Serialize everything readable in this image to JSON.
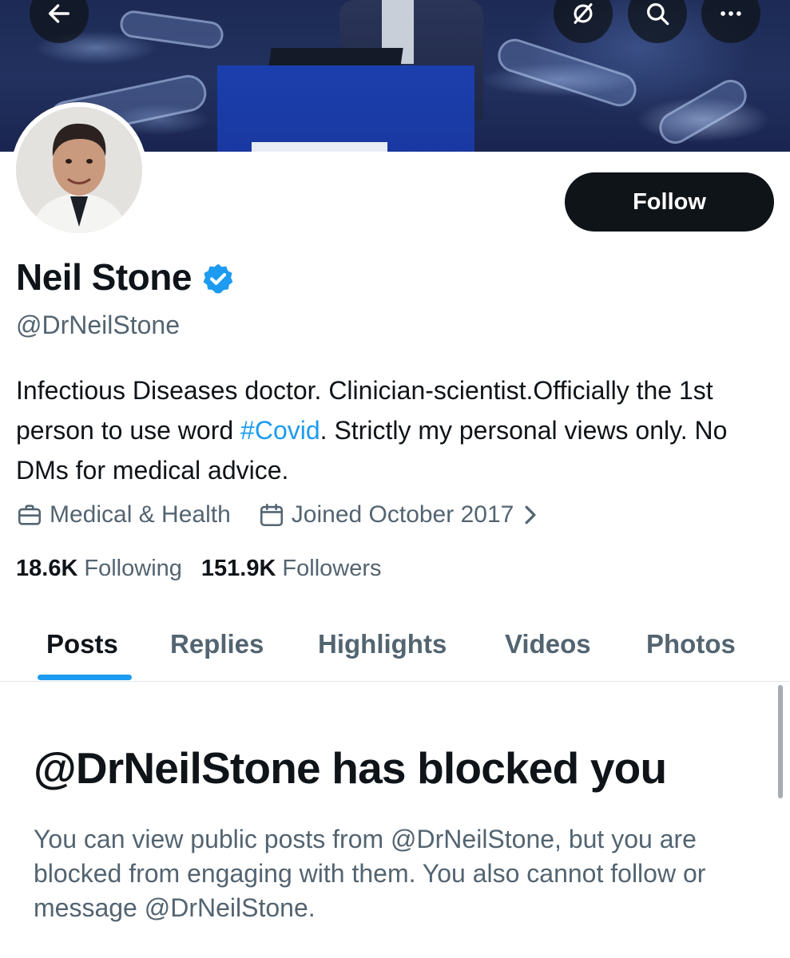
{
  "colors": {
    "accent": "#1d9bf0",
    "text_primary": "#0f1419",
    "text_secondary": "#536471",
    "follow_button_bg": "#0f1419",
    "verified_badge": "#1d9bf0"
  },
  "top_bar": {
    "back_icon": "arrow-left-icon",
    "grok_icon": "grok-icon",
    "search_icon": "search-icon",
    "more_icon": "more-icon"
  },
  "profile": {
    "follow_label": "Follow",
    "display_name": "Neil Stone",
    "verified": true,
    "handle": "@DrNeilStone",
    "bio": {
      "before_hashtag": "Infectious Diseases doctor. Clinician-scientist.Officially the 1st person to use word ",
      "hashtag": "#Covid",
      "after_hashtag": ". Strictly my personal views only. No DMs for medical advice."
    },
    "category": "Medical & Health",
    "joined": "Joined October 2017",
    "following_count": "18.6K",
    "following_label": "Following",
    "followers_count": "151.9K",
    "followers_label": "Followers"
  },
  "tabs": [
    {
      "label": "Posts",
      "active": true
    },
    {
      "label": "Replies",
      "active": false
    },
    {
      "label": "Highlights",
      "active": false
    },
    {
      "label": "Videos",
      "active": false
    },
    {
      "label": "Photos",
      "active": false
    }
  ],
  "blocked": {
    "title": "@DrNeilStone has blocked you",
    "message": "You can view public posts from @DrNeilStone, but you are blocked from engaging with them. You also cannot follow or message @DrNeilStone."
  }
}
